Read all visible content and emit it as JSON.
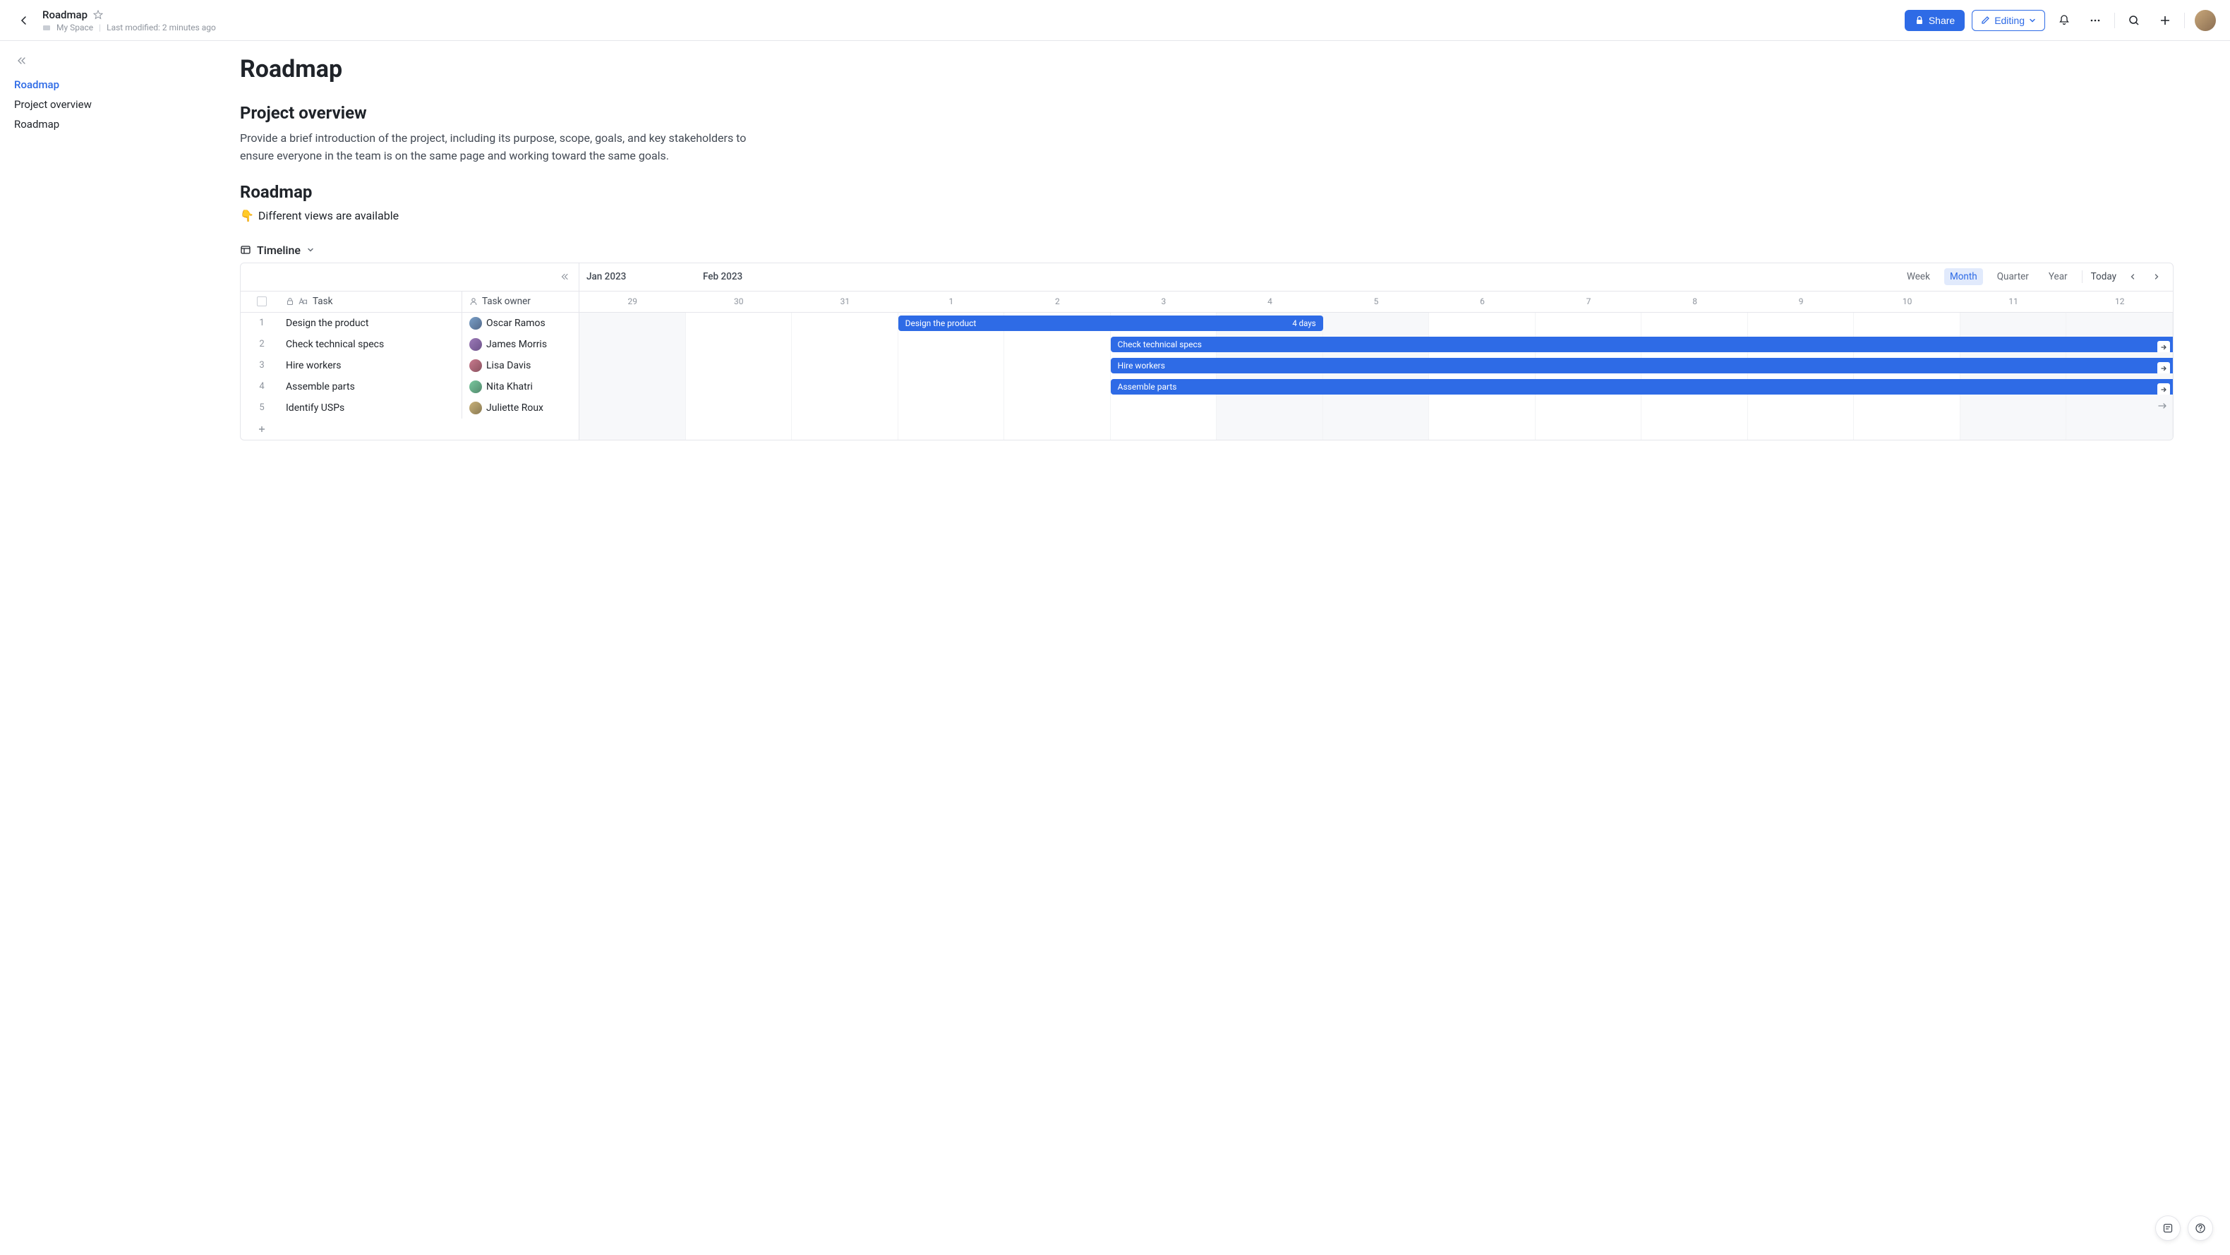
{
  "header": {
    "doc_title": "Roadmap",
    "breadcrumb_space": "My Space",
    "last_modified": "Last modified: 2 minutes ago",
    "share_label": "Share",
    "editing_label": "Editing"
  },
  "sidebar": {
    "items": [
      {
        "label": "Roadmap",
        "active": true
      },
      {
        "label": "Project overview",
        "active": false
      },
      {
        "label": "Roadmap",
        "active": false
      }
    ]
  },
  "document": {
    "page_title": "Roadmap",
    "overview_heading": "Project overview",
    "overview_body": "Provide a brief introduction of the project, including its purpose, scope, goals, and key stakeholders to ensure everyone in the team is on the same page and working toward the same goals.",
    "roadmap_heading": "Roadmap",
    "callout_emoji": "👇",
    "callout_text": "Different views are available"
  },
  "timeline": {
    "view_label": "Timeline",
    "month_labels": [
      "Jan 2023",
      "Feb 2023"
    ],
    "zoom": {
      "week": "Week",
      "month": "Month",
      "quarter": "Quarter",
      "year": "Year",
      "active": "Month"
    },
    "today_label": "Today",
    "columns": {
      "task": "Task",
      "owner": "Task owner"
    },
    "days": [
      "29",
      "30",
      "31",
      "1",
      "2",
      "3",
      "4",
      "5",
      "6",
      "7",
      "8",
      "9",
      "10",
      "11",
      "12"
    ],
    "weekend_idx": [
      0,
      6,
      7,
      13,
      14
    ],
    "tasks": [
      {
        "num": "1",
        "name": "Design the product",
        "owner": "Oscar Ramos",
        "avatar_bg": "linear-gradient(135deg,#7aa0c9,#52698a)",
        "bar_start": 3,
        "bar_span": 4,
        "duration": "4 days",
        "overflow": false
      },
      {
        "num": "2",
        "name": "Check technical specs",
        "owner": "James Morris",
        "avatar_bg": "linear-gradient(135deg,#9c7ab8,#6d528a)",
        "bar_start": 5,
        "bar_span": 10,
        "duration": "",
        "overflow": true
      },
      {
        "num": "3",
        "name": "Hire workers",
        "owner": "Lisa Davis",
        "avatar_bg": "linear-gradient(135deg,#c97a8e,#8a525f)",
        "bar_start": 5,
        "bar_span": 10,
        "duration": "",
        "overflow": true
      },
      {
        "num": "4",
        "name": "Assemble parts",
        "owner": "Nita Khatri",
        "avatar_bg": "linear-gradient(135deg,#7ac99f,#528a6d)",
        "bar_start": 5,
        "bar_span": 10,
        "duration": "",
        "overflow": true
      },
      {
        "num": "5",
        "name": "Identify USPs",
        "owner": "Juliette Roux",
        "avatar_bg": "linear-gradient(135deg,#c9b27a,#8a7a52)",
        "bar_start": null,
        "bar_span": 0,
        "duration": "",
        "overflow": false,
        "offscreen": true
      }
    ]
  }
}
